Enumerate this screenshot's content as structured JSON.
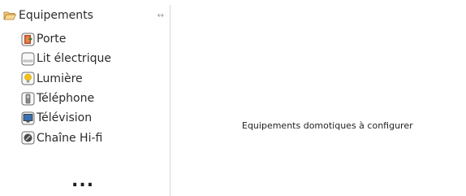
{
  "tree": {
    "root_label": "Equipements",
    "collapse_glyph": "↔",
    "root_icon": "folder-open-icon",
    "items": [
      {
        "label": "Porte",
        "icon": "door-icon"
      },
      {
        "label": "Lit électrique",
        "icon": "bed-icon"
      },
      {
        "label": "Lumière",
        "icon": "light-bulb-icon"
      },
      {
        "label": "Téléphone",
        "icon": "telephone-icon"
      },
      {
        "label": "Télévision",
        "icon": "television-icon"
      },
      {
        "label": "Chaîne Hi-fi",
        "icon": "hifi-icon"
      }
    ],
    "more_indicator": "..."
  },
  "main": {
    "hint": "Equipements domotiques à configurer"
  },
  "colors": {
    "folder": "#e6a23c",
    "door": "#c14a2f",
    "bulb": "#f2c218",
    "screen": "#3a6fb0"
  }
}
